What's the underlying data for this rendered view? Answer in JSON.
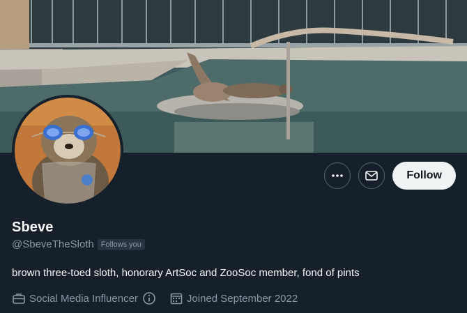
{
  "profile": {
    "display_name": "Sbeve",
    "handle": "@SbeveTheSloth",
    "follows_you_badge": "Follows you",
    "bio": "brown three-toed sloth, honorary ArtSoc and ZooSoc member, fond of pints",
    "category": "Social Media Influencer",
    "joined": "Joined September 2022"
  },
  "actions": {
    "more_icon": "ellipsis-icon",
    "message_icon": "envelope-icon",
    "follow_label": "Follow"
  },
  "meta_icons": {
    "category_icon": "briefcase-icon",
    "info_icon": "info-icon",
    "joined_icon": "calendar-icon"
  },
  "banner": {
    "description_icon": "banner-image"
  },
  "colors": {
    "background": "#15202b",
    "primary_text": "#f7f9f9",
    "secondary_text": "#8b98a5",
    "follow_button_bg": "#eff3f4",
    "badge_bg": "#273340"
  }
}
